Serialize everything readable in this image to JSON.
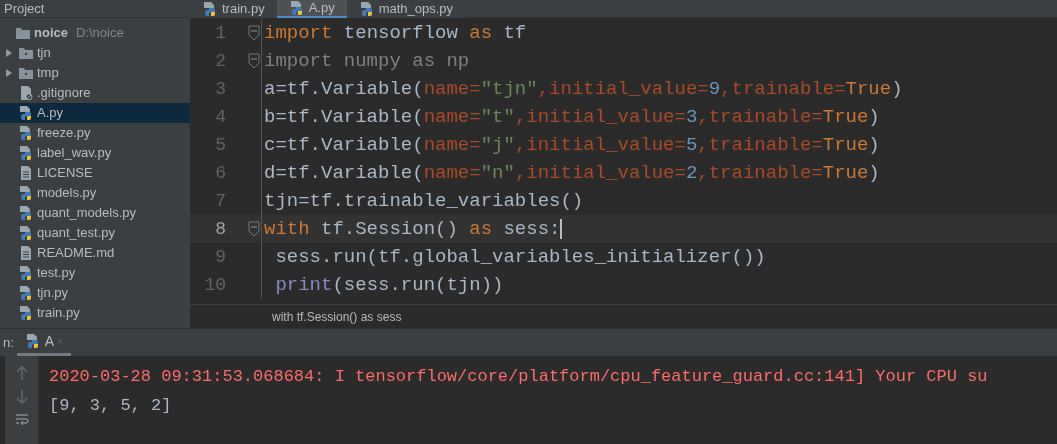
{
  "toolbar": {
    "project_label": "Project"
  },
  "editor_tabs": [
    {
      "label": "train.py",
      "selected": false
    },
    {
      "label": "A.py",
      "selected": true
    },
    {
      "label": "math_ops.py",
      "selected": false
    }
  ],
  "project_tree": {
    "label": "noice",
    "path": "D:\\noice",
    "children": [
      {
        "label": "tjn",
        "kind": "folder",
        "selected": false
      },
      {
        "label": "tmp",
        "kind": "folder",
        "selected": false
      },
      {
        "label": ".gitignore",
        "kind": "ignore",
        "selected": false
      },
      {
        "label": "A.py",
        "kind": "python",
        "selected": true
      },
      {
        "label": "freeze.py",
        "kind": "python",
        "selected": false
      },
      {
        "label": "label_wav.py",
        "kind": "python",
        "selected": false
      },
      {
        "label": "LICENSE",
        "kind": "text",
        "selected": false
      },
      {
        "label": "models.py",
        "kind": "python",
        "selected": false
      },
      {
        "label": "quant_models.py",
        "kind": "python",
        "selected": false
      },
      {
        "label": "quant_test.py",
        "kind": "python",
        "selected": false
      },
      {
        "label": "README.md",
        "kind": "text",
        "selected": false
      },
      {
        "label": "test.py",
        "kind": "python",
        "selected": false
      },
      {
        "label": "tjn.py",
        "kind": "python",
        "selected": false
      },
      {
        "label": "train.py",
        "kind": "python",
        "selected": false
      }
    ]
  },
  "code_lines": [
    {
      "number": "1",
      "fold": true,
      "current": false,
      "tokens": [
        {
          "kind": "keyword",
          "text": "import"
        },
        {
          "kind": "plain",
          "text": " tensorflow "
        },
        {
          "kind": "keyword",
          "text": "as"
        },
        {
          "kind": "plain",
          "text": " tf"
        }
      ]
    },
    {
      "number": "2",
      "fold": true,
      "current": false,
      "tokens": [
        {
          "kind": "unused",
          "text": "import numpy as np"
        }
      ]
    },
    {
      "number": "3",
      "fold": false,
      "current": false,
      "tokens": [
        {
          "kind": "plain",
          "text": "a=tf.Variable("
        },
        {
          "kind": "param",
          "text": "name="
        },
        {
          "kind": "string",
          "text": "\"tjn\""
        },
        {
          "kind": "param",
          "text": ",initial_value="
        },
        {
          "kind": "number",
          "text": "9"
        },
        {
          "kind": "param",
          "text": ",trainable="
        },
        {
          "kind": "keyword",
          "text": "True"
        },
        {
          "kind": "plain",
          "text": ")"
        }
      ]
    },
    {
      "number": "4",
      "fold": false,
      "current": false,
      "tokens": [
        {
          "kind": "plain",
          "text": "b=tf.Variable("
        },
        {
          "kind": "param",
          "text": "name="
        },
        {
          "kind": "string",
          "text": "\"t\""
        },
        {
          "kind": "param",
          "text": ",initial_value="
        },
        {
          "kind": "number",
          "text": "3"
        },
        {
          "kind": "param",
          "text": ",trainable="
        },
        {
          "kind": "keyword",
          "text": "True"
        },
        {
          "kind": "plain",
          "text": ")"
        }
      ]
    },
    {
      "number": "5",
      "fold": false,
      "current": false,
      "tokens": [
        {
          "kind": "plain",
          "text": "c=tf.Variable("
        },
        {
          "kind": "param",
          "text": "name="
        },
        {
          "kind": "string",
          "text": "\"j\""
        },
        {
          "kind": "param",
          "text": ",initial_value="
        },
        {
          "kind": "number",
          "text": "5"
        },
        {
          "kind": "param",
          "text": ",trainable="
        },
        {
          "kind": "keyword",
          "text": "True"
        },
        {
          "kind": "plain",
          "text": ")"
        }
      ]
    },
    {
      "number": "6",
      "fold": false,
      "current": false,
      "tokens": [
        {
          "kind": "plain",
          "text": "d=tf.Variable("
        },
        {
          "kind": "param",
          "text": "name="
        },
        {
          "kind": "string",
          "text": "\"n\""
        },
        {
          "kind": "param",
          "text": ",initial_value="
        },
        {
          "kind": "number",
          "text": "2"
        },
        {
          "kind": "param",
          "text": ",trainable="
        },
        {
          "kind": "keyword",
          "text": "True"
        },
        {
          "kind": "plain",
          "text": ")"
        }
      ]
    },
    {
      "number": "7",
      "fold": false,
      "current": false,
      "tokens": [
        {
          "kind": "plain",
          "text": "tjn=tf.trainable_variables()"
        }
      ]
    },
    {
      "number": "8",
      "fold": true,
      "current": true,
      "tokens": [
        {
          "kind": "keyword",
          "text": "with"
        },
        {
          "kind": "plain",
          "text": " tf.Session() "
        },
        {
          "kind": "keyword",
          "text": "as"
        },
        {
          "kind": "plain",
          "text": " sess:"
        }
      ]
    },
    {
      "number": "9",
      "fold": false,
      "current": false,
      "tokens": [
        {
          "kind": "plain",
          "text": " sess.run(tf.global_variables_initializer())"
        }
      ]
    },
    {
      "number": "10",
      "fold": false,
      "current": false,
      "tokens": [
        {
          "kind": "builtin",
          "text": " print"
        },
        {
          "kind": "plain",
          "text": "(sess.run(tjn))"
        }
      ]
    }
  ],
  "breadcrumb": "with tf.Session() as sess",
  "run_panel": {
    "label": "n:",
    "tabs": [
      {
        "label": "A",
        "selected": true
      }
    ],
    "output": [
      {
        "kind": "error",
        "text": "2020-03-28 09:31:53.068684: I tensorflow/core/platform/cpu_feature_guard.cc:141] Your CPU su"
      },
      {
        "kind": "normal",
        "text": "[9, 3, 5, 2]"
      }
    ]
  }
}
